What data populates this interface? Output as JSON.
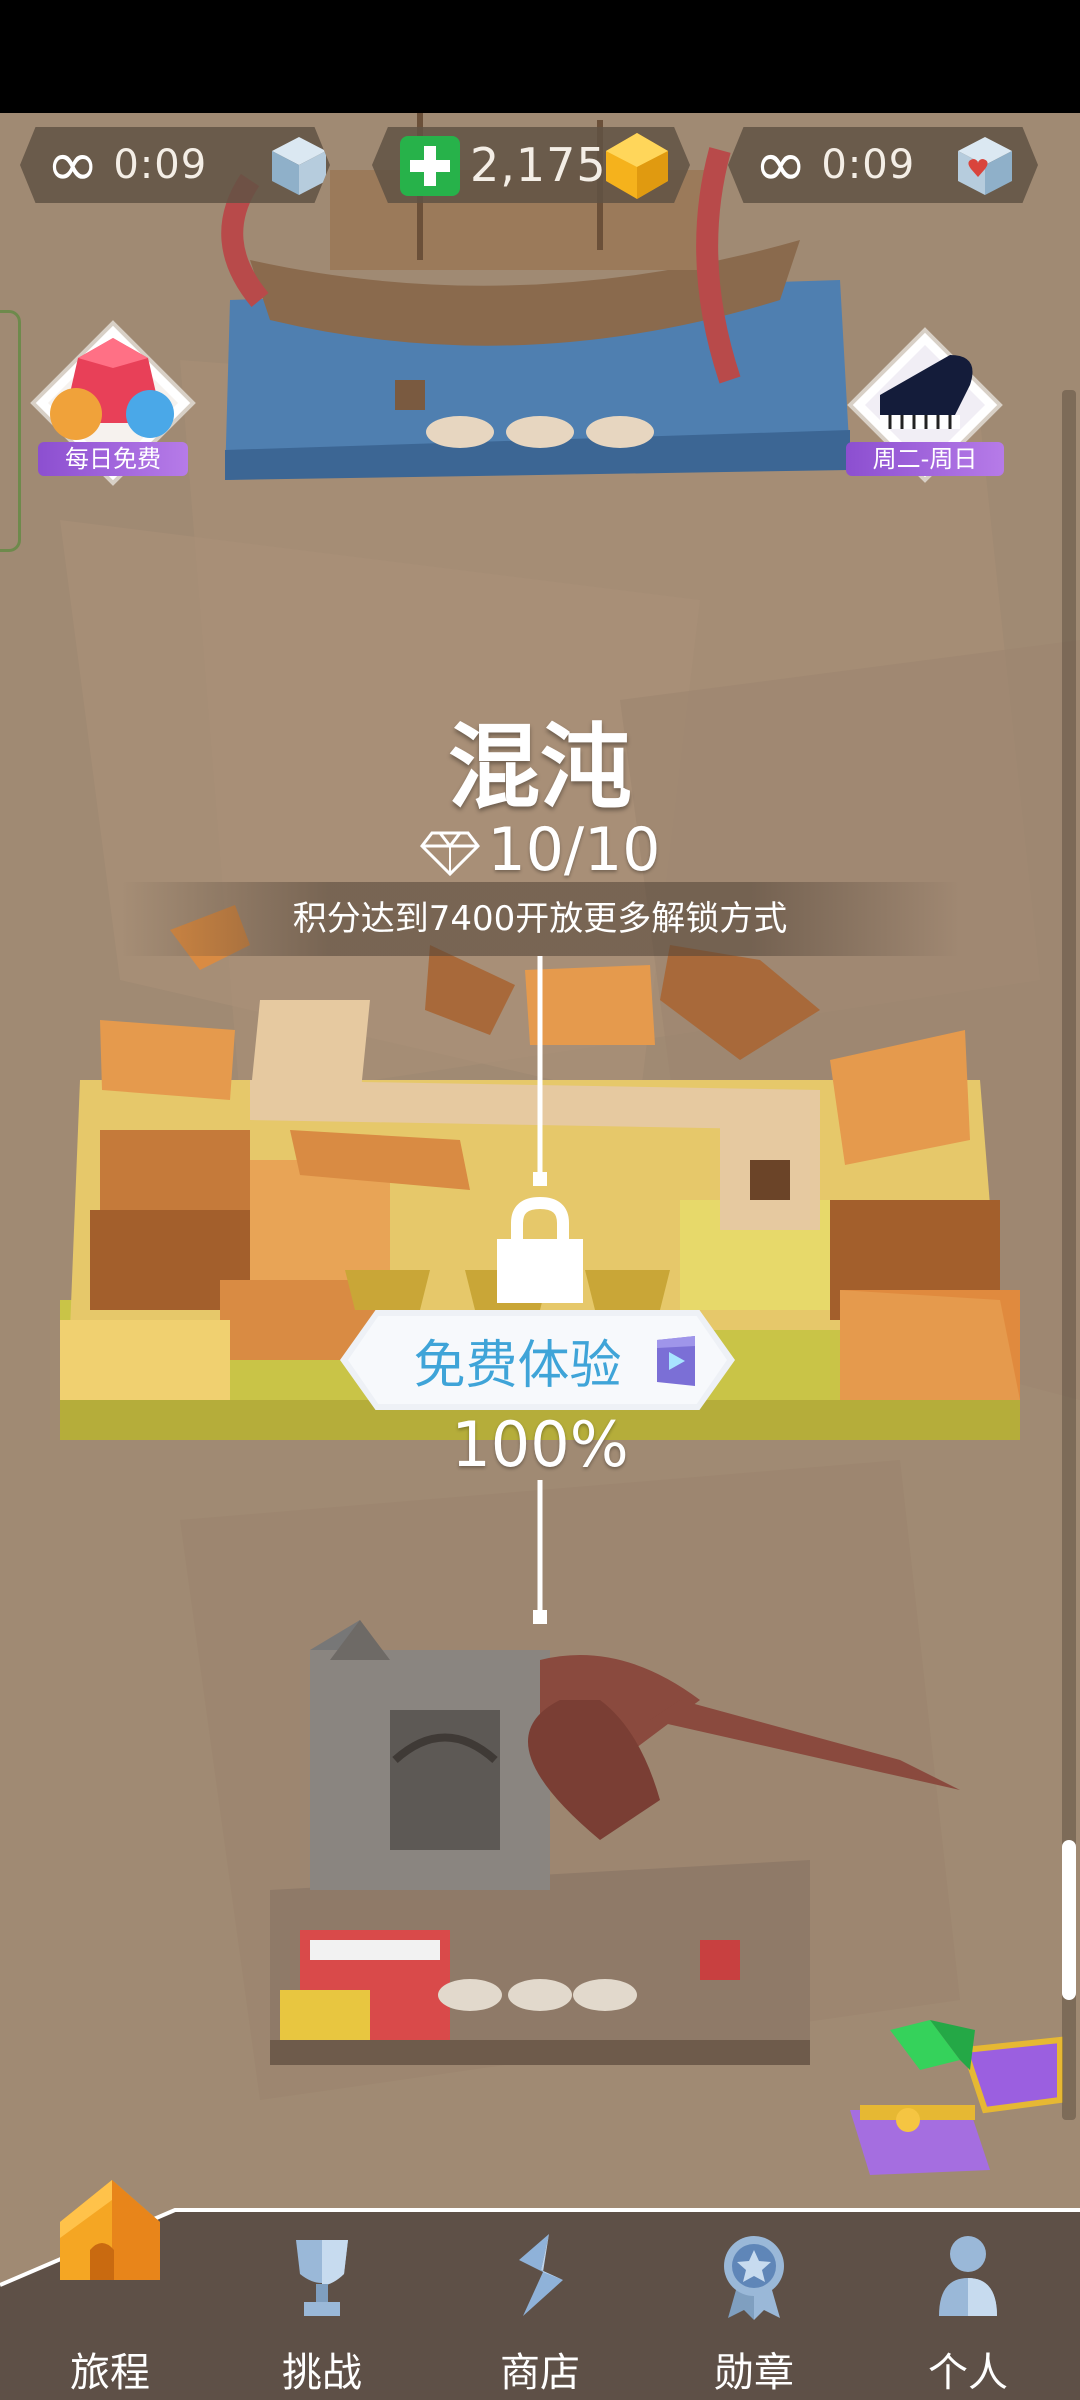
{
  "hud": {
    "left_timer": {
      "icon": "infinity-icon",
      "value": "0:09",
      "resource_icon": "cube-icon"
    },
    "gems": {
      "add_icon": "plus-icon",
      "value": "2,175",
      "resource_icon": "gold-gem-icon"
    },
    "right_timer": {
      "icon": "infinity-icon",
      "value": "0:09",
      "resource_icon": "heart-cube-icon"
    }
  },
  "badges": {
    "daily": {
      "icon": "gems-icon",
      "label": "每日免费"
    },
    "weekly": {
      "icon": "piano-icon",
      "label": "周二-周日"
    }
  },
  "level": {
    "title": "混沌",
    "progress": "10/10",
    "progress_icon": "diamond-icon",
    "unlock_text": "积分达到7400开放更多解锁方式",
    "lock_icon": "lock-icon",
    "free_trial_label": "免费体验",
    "video_icon": "video-ad-icon",
    "completion": "100%"
  },
  "nav": {
    "items": [
      {
        "label": "旅程",
        "icon": "house-icon",
        "active": true
      },
      {
        "label": "挑战",
        "icon": "trophy-icon",
        "active": false
      },
      {
        "label": "商店",
        "icon": "shop-icon",
        "active": false
      },
      {
        "label": "勋章",
        "icon": "medal-icon",
        "active": false
      },
      {
        "label": "个人",
        "icon": "profile-icon",
        "active": false
      }
    ]
  },
  "colors": {
    "background": "#a08a73",
    "accent_gold": "#f5b21c",
    "accent_green": "#27b24a",
    "trial_text": "#3fa4d8",
    "badge_purple": "#9b5fe0"
  }
}
